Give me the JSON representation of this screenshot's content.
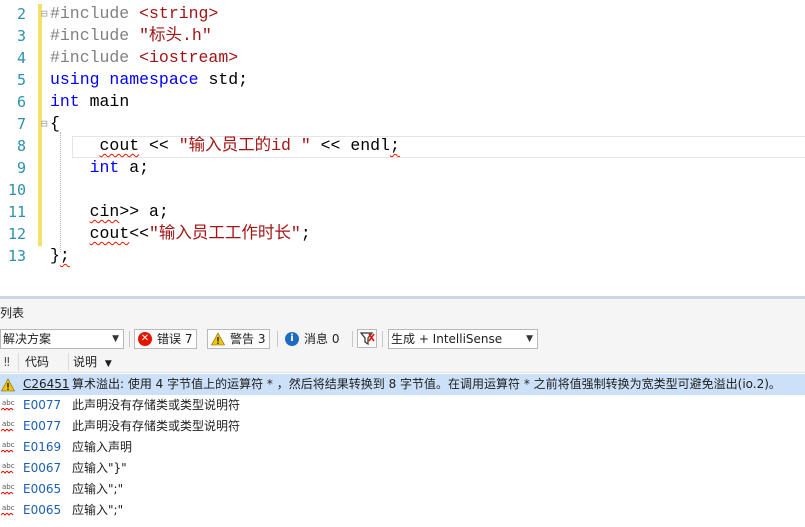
{
  "editor": {
    "lines": [
      {
        "num": "2",
        "fold": "⊟",
        "segs": [
          {
            "c": "pp",
            "t": "#include "
          },
          {
            "c": "s",
            "t": "<string>"
          }
        ]
      },
      {
        "num": "3",
        "fold": "",
        "segs": [
          {
            "c": "pp",
            "t": "#include "
          },
          {
            "c": "s",
            "t": "\"标头.h\""
          }
        ]
      },
      {
        "num": "4",
        "fold": "",
        "segs": [
          {
            "c": "pp",
            "t": "#include "
          },
          {
            "c": "s",
            "t": "<iostream>"
          }
        ]
      },
      {
        "num": "5",
        "fold": "",
        "segs": [
          {
            "c": "k",
            "t": "using"
          },
          {
            "c": "",
            "t": " "
          },
          {
            "c": "k",
            "t": "namespace"
          },
          {
            "c": "",
            "t": " std;"
          }
        ]
      },
      {
        "num": "6",
        "fold": "",
        "segs": [
          {
            "c": "k",
            "t": "int"
          },
          {
            "c": "",
            "t": " main"
          }
        ]
      },
      {
        "num": "7",
        "fold": "⊟",
        "segs": [
          {
            "c": "",
            "t": "{"
          }
        ]
      },
      {
        "num": "8",
        "fold": "",
        "segs": [
          {
            "c": "",
            "t": "     "
          },
          {
            "c": "squiggle",
            "t": "cout"
          },
          {
            "c": "",
            "t": " << "
          },
          {
            "c": "s",
            "t": "\"输入员工的id \""
          },
          {
            "c": "",
            "t": " << endl"
          },
          {
            "c": "squiggle",
            "t": ";"
          }
        ]
      },
      {
        "num": "9",
        "fold": "",
        "segs": [
          {
            "c": "",
            "t": "    "
          },
          {
            "c": "k",
            "t": "int"
          },
          {
            "c": "",
            "t": " a;"
          }
        ]
      },
      {
        "num": "10",
        "fold": "",
        "segs": [
          {
            "c": "",
            "t": ""
          }
        ]
      },
      {
        "num": "11",
        "fold": "",
        "segs": [
          {
            "c": "",
            "t": "    "
          },
          {
            "c": "squiggle",
            "t": "cin"
          },
          {
            "c": "",
            "t": ">> a;"
          }
        ]
      },
      {
        "num": "12",
        "fold": "",
        "segs": [
          {
            "c": "",
            "t": "    "
          },
          {
            "c": "squiggle",
            "t": "cout"
          },
          {
            "c": "",
            "t": "<<"
          },
          {
            "c": "s",
            "t": "\"输入员工工作时长\""
          },
          {
            "c": "",
            "t": ";"
          }
        ]
      },
      {
        "num": "13",
        "fold": "",
        "segs": [
          {
            "c": "",
            "t": "}"
          },
          {
            "c": "squiggle",
            "t": ";"
          }
        ]
      }
    ]
  },
  "panel": {
    "title": "列表",
    "scope_selector": "解决方案",
    "errors_label": "错误 7",
    "warnings_label": "警告 3",
    "messages_label": "消息 0",
    "build_filter": "生成 + IntelliSense",
    "columns": {
      "code": "代码",
      "description": "说明"
    },
    "rows": [
      {
        "severity": "warning",
        "code": "C26451",
        "description": "算术溢出: 使用 4 字节值上的运算符 * ，然后将结果转换到 8 字节值。在调用运算符 * 之前将值强制转换为宽类型可避免溢出(io.2)。",
        "selected": true
      },
      {
        "severity": "intellisense-error",
        "code": "E0077",
        "description": "此声明没有存储类或类型说明符"
      },
      {
        "severity": "intellisense-error",
        "code": "E0077",
        "description": "此声明没有存储类或类型说明符"
      },
      {
        "severity": "intellisense-error",
        "code": "E0169",
        "description": "应输入声明"
      },
      {
        "severity": "intellisense-error",
        "code": "E0067",
        "description": "应输入\"}\""
      },
      {
        "severity": "intellisense-error",
        "code": "E0065",
        "description": "应输入\";\""
      },
      {
        "severity": "intellisense-error",
        "code": "E0065",
        "description": "应输入\";\""
      }
    ]
  },
  "colors": {
    "keyword": "#0000ff",
    "string": "#a31515",
    "preprocessor": "#808080",
    "line_number": "#2b91af",
    "error": "#e51400",
    "selection": "#cce0f7"
  }
}
